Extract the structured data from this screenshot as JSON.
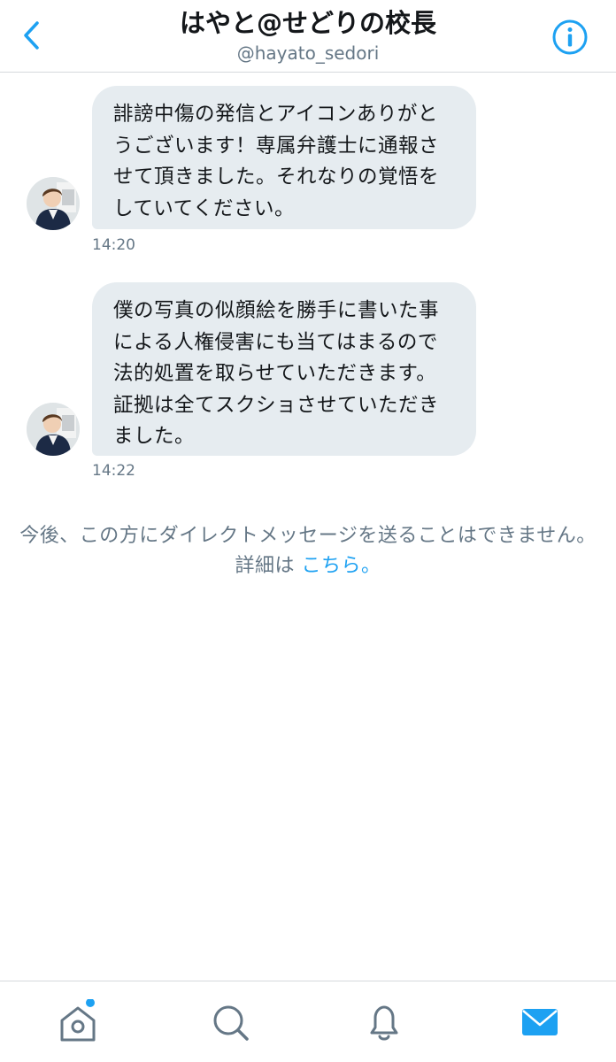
{
  "header": {
    "title": "はやと@せどりの校長",
    "handle": "@hayato_sedori",
    "back_icon": "chevron-left-icon",
    "info_icon": "info-icon"
  },
  "messages": [
    {
      "text": "誹謗中傷の発信とアイコンありがとうございます！専属弁護士に通報させて頂きました。それなりの覚悟をしていてください。",
      "time": "14:20"
    },
    {
      "text": "僕の写真の似顔絵を勝手に書いた事による人権侵害にも当てはまるので法的処置を取らせていただきます。証拠は全てスクショさせていただきました。",
      "time": "14:22"
    }
  ],
  "notice": {
    "text": "今後、この方にダイレクトメッセージを送ることはできません。詳細は",
    "link": "こちら。"
  },
  "tabbar": {
    "items": [
      {
        "icon": "home-icon",
        "has_notification_dot": true
      },
      {
        "icon": "search-icon"
      },
      {
        "icon": "bell-icon"
      },
      {
        "icon": "mail-icon",
        "active": true
      }
    ]
  },
  "colors": {
    "accent": "#1da1f2",
    "bubble": "#e6ecf0",
    "secondary_text": "#657786"
  }
}
